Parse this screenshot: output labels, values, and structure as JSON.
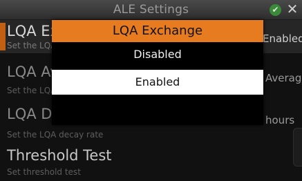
{
  "window": {
    "title": "ALE Settings"
  },
  "settings": [
    {
      "title": "LQA Exchange",
      "subtitle": "Set the LQA exchange",
      "value": "Enabled"
    },
    {
      "title": "LQA Averaging",
      "subtitle": "Set the LQA averaging",
      "value": "Averaging"
    },
    {
      "title": "LQA Decay",
      "subtitle": "Set the LQA decay rate",
      "value": "hours"
    },
    {
      "title": "Threshold Test",
      "subtitle": "Set threshold test",
      "value": ""
    }
  ],
  "dialog": {
    "title": "LQA Exchange",
    "options": [
      "Disabled",
      "Enabled"
    ],
    "selected": "Enabled"
  },
  "colors": {
    "accent": "#e67b1f",
    "selection": "#ffffff",
    "ok": "#3a8a3a"
  },
  "icons": {
    "ok": "checkmark-icon",
    "close": "close-icon"
  }
}
